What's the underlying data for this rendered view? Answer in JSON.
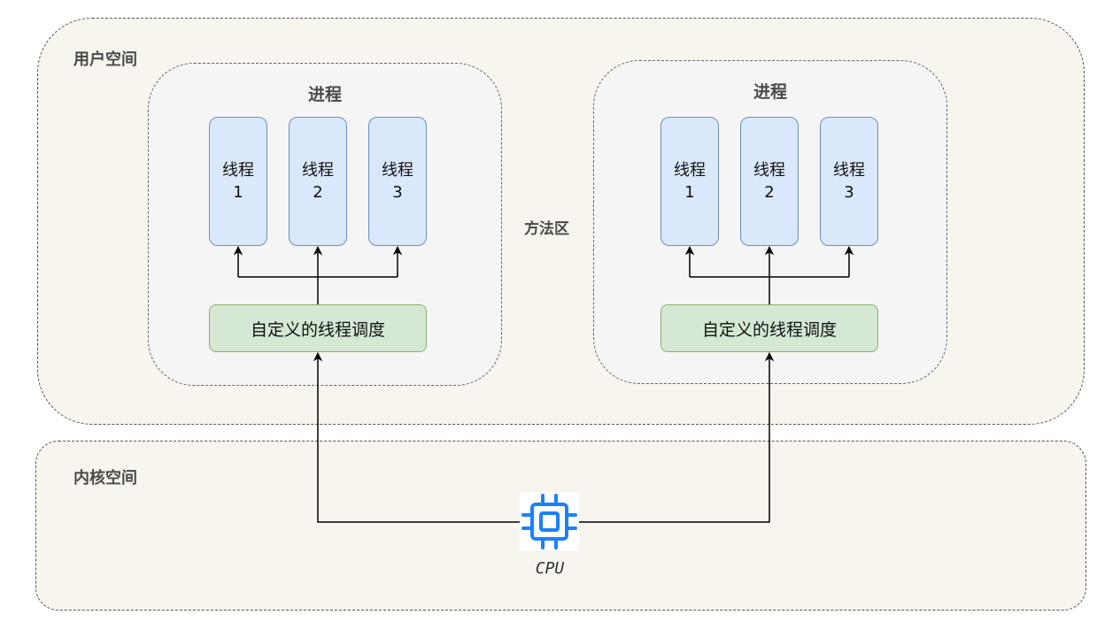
{
  "zones": {
    "user_space": "用户空间",
    "kernel_space": "内核空间"
  },
  "method_area": "方法区",
  "processes": [
    {
      "title": "进程",
      "threads": [
        {
          "name": "线程",
          "num": "1"
        },
        {
          "name": "线程",
          "num": "2"
        },
        {
          "name": "线程",
          "num": "3"
        }
      ],
      "scheduler": "自定义的线程调度"
    },
    {
      "title": "进程",
      "threads": [
        {
          "name": "线程",
          "num": "1"
        },
        {
          "name": "线程",
          "num": "2"
        },
        {
          "name": "线程",
          "num": "3"
        }
      ],
      "scheduler": "自定义的线程调度"
    }
  ],
  "cpu": {
    "label": "CPU",
    "icon": "cpu-chip-icon",
    "color": "#1a82ff"
  },
  "colors": {
    "thread_fill": "#dae8fc",
    "thread_stroke": "#6c8ebf",
    "sched_fill": "#d5e8d4",
    "sched_stroke": "#82b366",
    "zone_fill": "#f7f5ee",
    "process_fill": "#f5f5f5"
  }
}
